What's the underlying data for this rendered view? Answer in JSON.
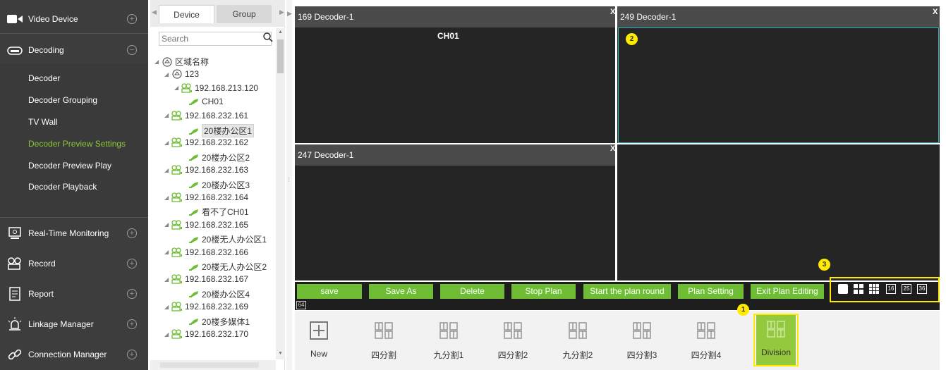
{
  "nav": {
    "groups": [
      {
        "label": "Video Device",
        "icon": "camera-icon",
        "toggle": "+"
      },
      {
        "label": "Decoding",
        "icon": "decoder-icon",
        "toggle": "−"
      },
      {
        "label": "Real-Time Monitoring",
        "icon": "monitor-icon",
        "toggle": "+"
      },
      {
        "label": "Record",
        "icon": "record-icon",
        "toggle": "+"
      },
      {
        "label": "Report",
        "icon": "report-icon",
        "toggle": "+"
      },
      {
        "label": "Linkage Manager",
        "icon": "alarm-light-icon",
        "toggle": "+"
      },
      {
        "label": "Connection Manager",
        "icon": "link-icon",
        "toggle": "+"
      }
    ],
    "decoding_items": [
      {
        "label": "Decoder"
      },
      {
        "label": "Decoder Grouping"
      },
      {
        "label": "TV Wall"
      },
      {
        "label": "Decoder Preview Settings"
      },
      {
        "label": "Decoder Preview Play"
      },
      {
        "label": "Decoder Playback"
      }
    ],
    "accent_color": "#8dc63f"
  },
  "tree": {
    "tabs": {
      "device": "Device",
      "group": "Group"
    },
    "search_placeholder": "Search",
    "nodes": [
      {
        "label": "区域名称",
        "icon": "area-icon"
      },
      {
        "label": "123",
        "icon": "area-icon"
      },
      {
        "label": "192.168.213.120",
        "icon": "device-icon"
      },
      {
        "label": "CH01",
        "icon": "channel-icon"
      },
      {
        "label": "192.168.232.161",
        "icon": "device-icon"
      },
      {
        "label": "20楼办公区1",
        "icon": "channel-icon"
      },
      {
        "label": "192.168.232.162",
        "icon": "device-icon"
      },
      {
        "label": "20楼办公区2",
        "icon": "channel-icon"
      },
      {
        "label": "192.168.232.163",
        "icon": "device-icon"
      },
      {
        "label": "20楼办公区3",
        "icon": "channel-icon"
      },
      {
        "label": "192.168.232.164",
        "icon": "device-icon"
      },
      {
        "label": "看不了CH01",
        "icon": "channel-icon"
      },
      {
        "label": "192.168.232.165",
        "icon": "device-icon"
      },
      {
        "label": "20楼无人办公区1",
        "icon": "channel-icon"
      },
      {
        "label": "192.168.232.166",
        "icon": "device-icon"
      },
      {
        "label": "20楼无人办公区2",
        "icon": "channel-icon"
      },
      {
        "label": "192.168.232.167",
        "icon": "device-icon"
      },
      {
        "label": "20楼办公区4",
        "icon": "channel-icon"
      },
      {
        "label": "192.168.232.169",
        "icon": "device-icon"
      },
      {
        "label": "20楼多媒体1",
        "icon": "channel-icon"
      },
      {
        "label": "192.168.232.170",
        "icon": "device-icon"
      }
    ]
  },
  "panes": [
    {
      "title": "169 Decoder-1",
      "channel": "CH01"
    },
    {
      "title": "249 Decoder-1",
      "marker": "2"
    },
    {
      "title": "247 Decoder-1"
    },
    {
      "title": ""
    }
  ],
  "pane_close": "X",
  "toolbar": {
    "buttons": [
      "save",
      "Save As",
      "Delete",
      "Stop Plan",
      "Start the plan round",
      "Plan Setting",
      "Exit Plan Editing"
    ],
    "layout_options": [
      "1",
      "4",
      "9",
      "16",
      "25",
      "36",
      "64"
    ],
    "marker": "3",
    "button_color": "#6fbd34"
  },
  "plans": {
    "items": [
      {
        "label": "New",
        "icon": "plus-grid-icon"
      },
      {
        "label": "四分割",
        "icon": "grid-icon"
      },
      {
        "label": "九分割1",
        "icon": "grid-icon"
      },
      {
        "label": "四分割2",
        "icon": "grid-icon"
      },
      {
        "label": "九分割2",
        "icon": "grid-icon"
      },
      {
        "label": "四分割3",
        "icon": "grid-icon"
      },
      {
        "label": "四分割4",
        "icon": "grid-icon"
      },
      {
        "label": "Division",
        "icon": "grid-icon",
        "selected": true
      }
    ],
    "marker": "1",
    "highlight_color": "#ffea00"
  }
}
